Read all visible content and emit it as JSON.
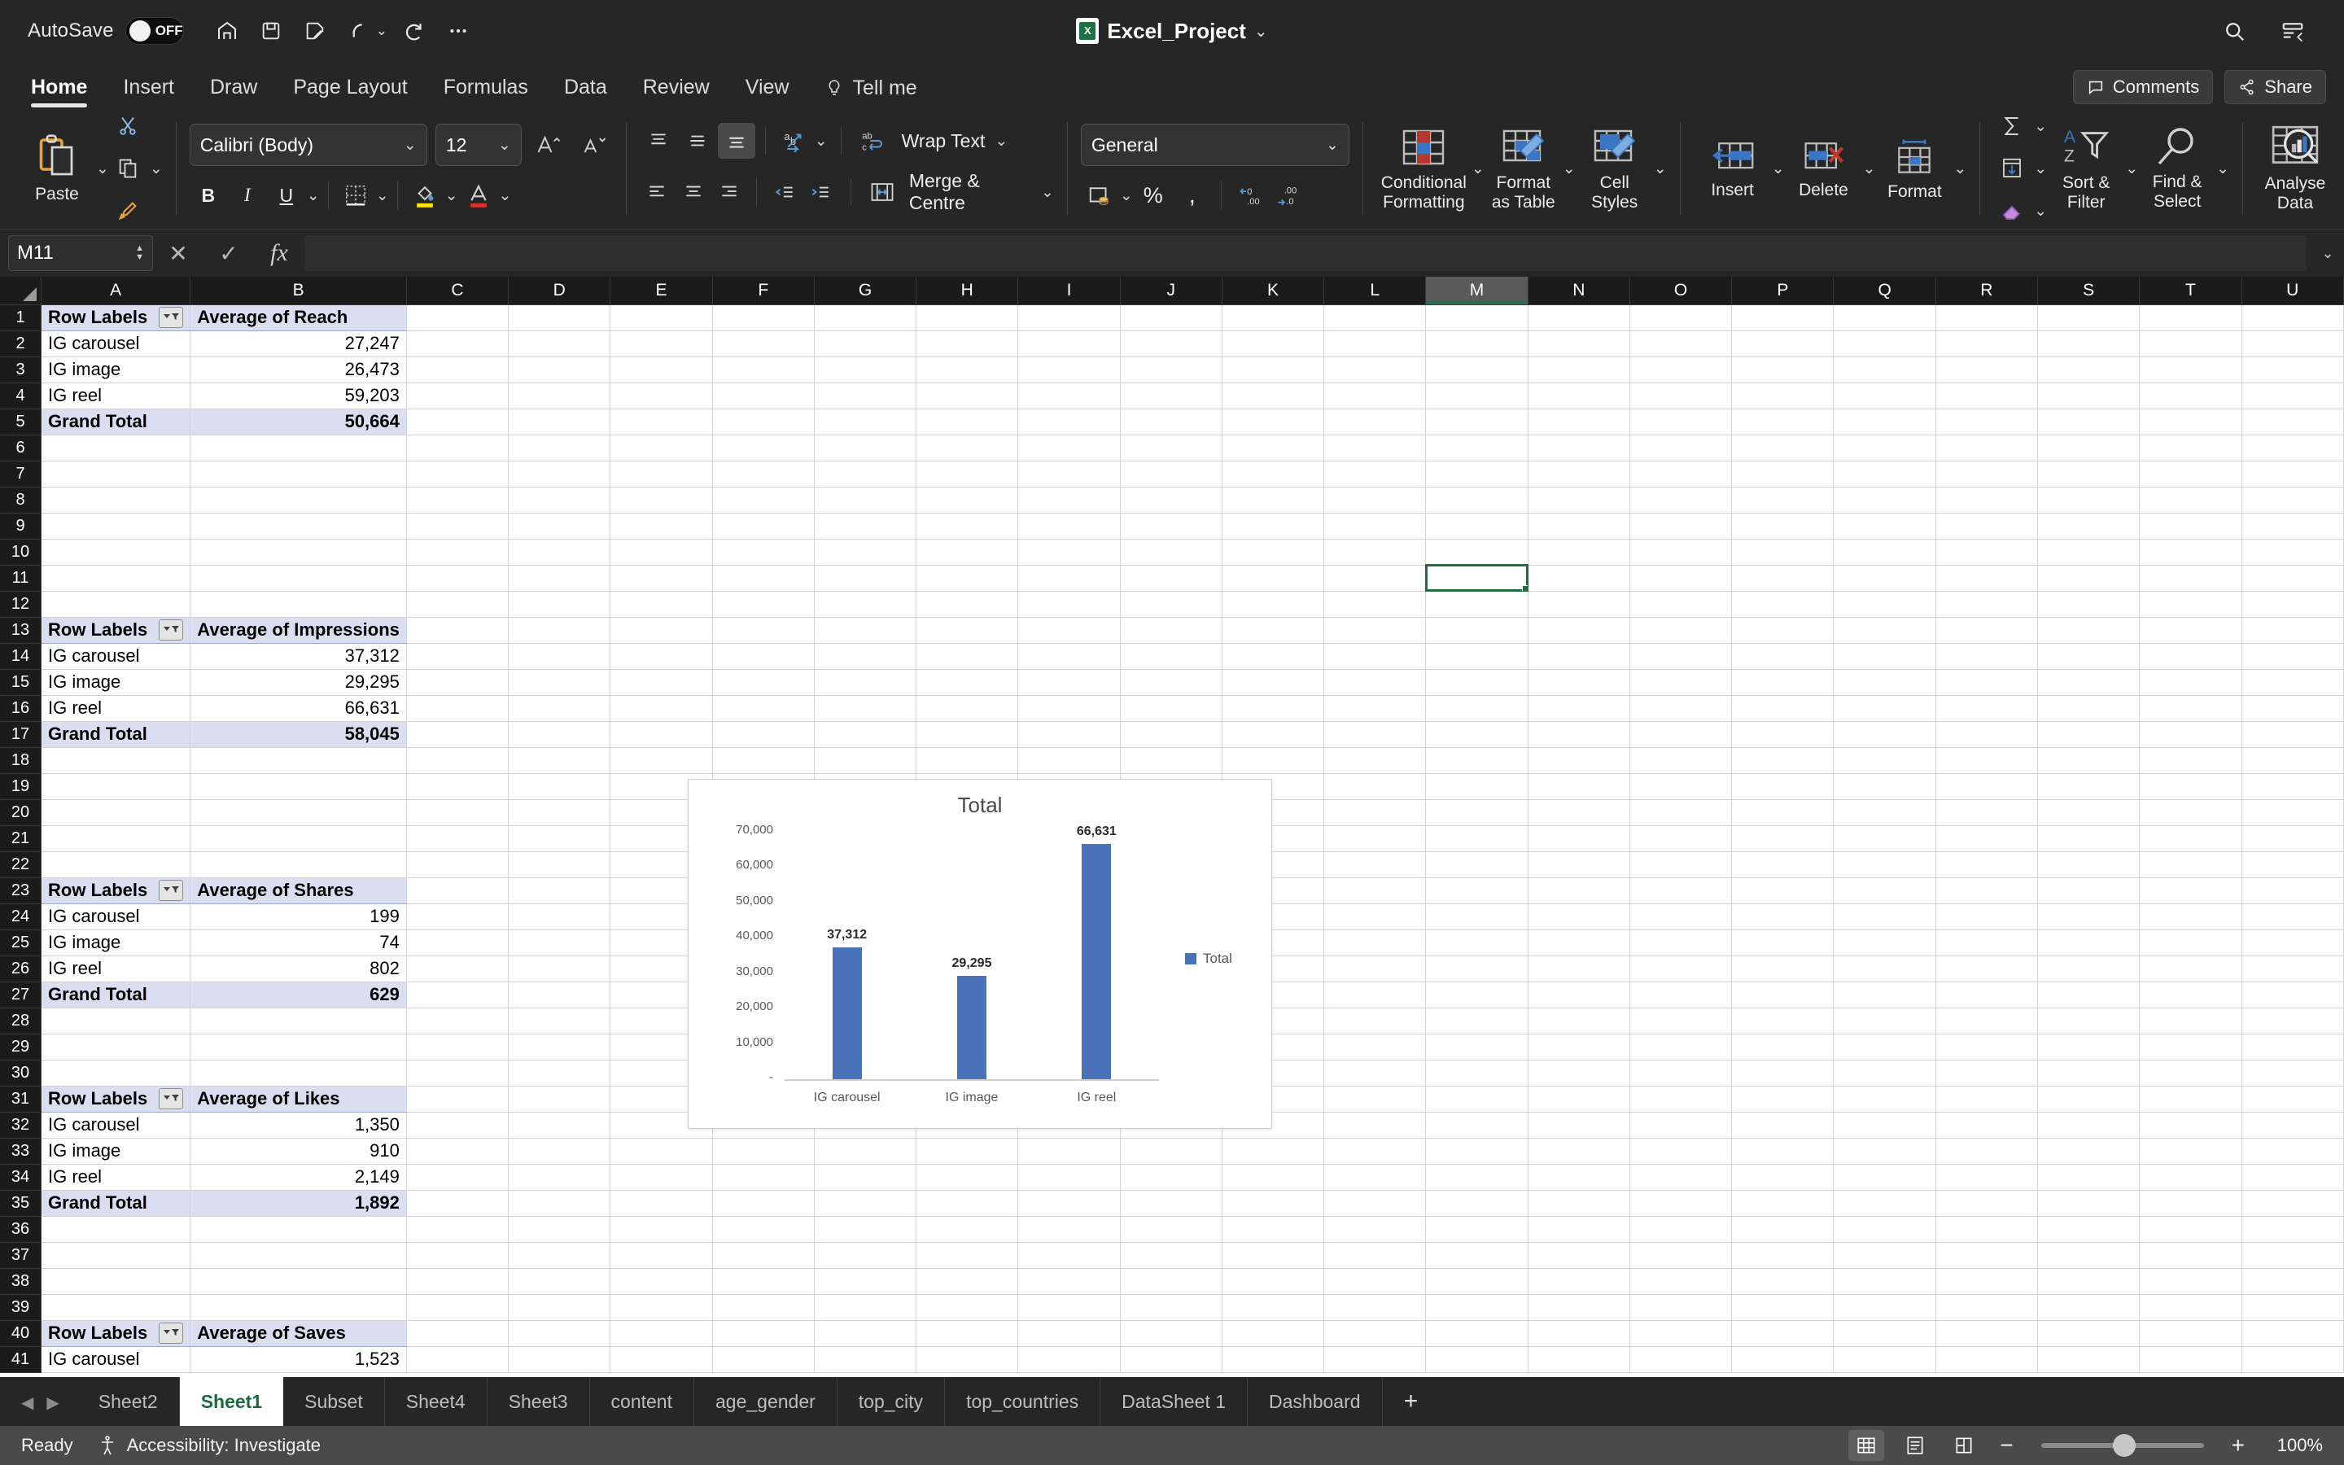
{
  "titlebar": {
    "autosave_label": "AutoSave",
    "autosave_state": "OFF",
    "document_title": "Excel_Project",
    "icons": [
      "home-icon",
      "save-icon",
      "save-as-icon",
      "undo-icon",
      "redo-icon",
      "more-commands-icon",
      "search-icon",
      "ribbon-display-icon"
    ]
  },
  "ribbon_tabs": {
    "items": [
      {
        "label": "Home",
        "active": true
      },
      {
        "label": "Insert",
        "active": false
      },
      {
        "label": "Draw",
        "active": false
      },
      {
        "label": "Page Layout",
        "active": false
      },
      {
        "label": "Formulas",
        "active": false
      },
      {
        "label": "Data",
        "active": false
      },
      {
        "label": "Review",
        "active": false
      },
      {
        "label": "View",
        "active": false
      }
    ],
    "tell_me": "Tell me",
    "comments": "Comments",
    "share": "Share"
  },
  "ribbon": {
    "clipboard": {
      "paste": "Paste",
      "cut": "cut-icon",
      "copy": "copy-icon",
      "format_painter": "format-painter-icon"
    },
    "font": {
      "family": "Calibri (Body)",
      "size": "12",
      "grow": "A^",
      "shrink": "Av",
      "bold": "B",
      "italic": "I",
      "underline": "U",
      "borders": "borders-icon",
      "fill": "fill-color-icon",
      "fontcolor": "font-color-icon"
    },
    "alignment": {
      "wrap_text": "Wrap Text",
      "merge_centre": "Merge & Centre",
      "orientation": "orientation-icon"
    },
    "number": {
      "format": "General",
      "accounting": "accounting-icon",
      "percent": "%",
      "comma": ",",
      "increase_decimal": "increase-decimal-icon",
      "decrease_decimal": "decrease-decimal-icon"
    },
    "styles": {
      "conditional_formatting": "Conditional\nFormatting",
      "conditional_formatting_l1": "Conditional",
      "conditional_formatting_l2": "Formatting",
      "format_as_table_l1": "Format",
      "format_as_table_l2": "as Table",
      "cell_styles_l1": "Cell",
      "cell_styles_l2": "Styles"
    },
    "cells": {
      "insert": "Insert",
      "delete": "Delete",
      "format": "Format"
    },
    "editing": {
      "autosum": "autosum-icon",
      "fill": "fill-down-icon",
      "clear": "clear-icon",
      "sort_filter_l1": "Sort &",
      "sort_filter_l2": "Filter",
      "find_select_l1": "Find &",
      "find_select_l2": "Select"
    },
    "analysis": {
      "analyse_data_l1": "Analyse",
      "analyse_data_l2": "Data"
    }
  },
  "formula_bar": {
    "name_box": "M11",
    "cancel": "cancel-icon",
    "enter": "enter-icon",
    "fx": "fx",
    "value": ""
  },
  "grid": {
    "columns": [
      "A",
      "B",
      "C",
      "D",
      "E",
      "F",
      "G",
      "H",
      "I",
      "J",
      "K",
      "L",
      "M",
      "N",
      "O",
      "P",
      "Q",
      "R",
      "S",
      "T",
      "U"
    ],
    "selected_cell": "M11",
    "selected_column": "M",
    "rows": [
      {
        "n": 1,
        "a": "Row Labels",
        "b": "Average of Reach",
        "kind": "hdr",
        "filter": true
      },
      {
        "n": 2,
        "a": "IG carousel",
        "b": "27,247",
        "kind": "data"
      },
      {
        "n": 3,
        "a": "IG image",
        "b": "26,473",
        "kind": "data"
      },
      {
        "n": 4,
        "a": "IG reel",
        "b": "59,203",
        "kind": "data"
      },
      {
        "n": 5,
        "a": "Grand Total",
        "b": "50,664",
        "kind": "tot"
      },
      {
        "n": 6,
        "a": "",
        "b": "",
        "kind": "empty"
      },
      {
        "n": 7,
        "a": "",
        "b": "",
        "kind": "empty"
      },
      {
        "n": 8,
        "a": "",
        "b": "",
        "kind": "empty"
      },
      {
        "n": 9,
        "a": "",
        "b": "",
        "kind": "empty"
      },
      {
        "n": 10,
        "a": "",
        "b": "",
        "kind": "empty"
      },
      {
        "n": 11,
        "a": "",
        "b": "",
        "kind": "empty"
      },
      {
        "n": 12,
        "a": "",
        "b": "",
        "kind": "empty"
      },
      {
        "n": 13,
        "a": "Row Labels",
        "b": "Average of Impressions",
        "kind": "hdr",
        "filter": true
      },
      {
        "n": 14,
        "a": "IG carousel",
        "b": "37,312",
        "kind": "data"
      },
      {
        "n": 15,
        "a": "IG image",
        "b": "29,295",
        "kind": "data"
      },
      {
        "n": 16,
        "a": "IG reel",
        "b": "66,631",
        "kind": "data"
      },
      {
        "n": 17,
        "a": "Grand Total",
        "b": "58,045",
        "kind": "tot"
      },
      {
        "n": 18,
        "a": "",
        "b": "",
        "kind": "empty"
      },
      {
        "n": 19,
        "a": "",
        "b": "",
        "kind": "empty"
      },
      {
        "n": 20,
        "a": "",
        "b": "",
        "kind": "empty"
      },
      {
        "n": 21,
        "a": "",
        "b": "",
        "kind": "empty"
      },
      {
        "n": 22,
        "a": "",
        "b": "",
        "kind": "empty"
      },
      {
        "n": 23,
        "a": "Row Labels",
        "b": "Average of Shares",
        "kind": "hdr",
        "filter": true
      },
      {
        "n": 24,
        "a": "IG carousel",
        "b": "199",
        "kind": "data"
      },
      {
        "n": 25,
        "a": "IG image",
        "b": "74",
        "kind": "data"
      },
      {
        "n": 26,
        "a": "IG reel",
        "b": "802",
        "kind": "data"
      },
      {
        "n": 27,
        "a": "Grand Total",
        "b": "629",
        "kind": "tot"
      },
      {
        "n": 28,
        "a": "",
        "b": "",
        "kind": "empty"
      },
      {
        "n": 29,
        "a": "",
        "b": "",
        "kind": "empty"
      },
      {
        "n": 30,
        "a": "",
        "b": "",
        "kind": "empty"
      },
      {
        "n": 31,
        "a": "Row Labels",
        "b": "Average of Likes",
        "kind": "hdr",
        "filter": true
      },
      {
        "n": 32,
        "a": "IG carousel",
        "b": "1,350",
        "kind": "data"
      },
      {
        "n": 33,
        "a": "IG image",
        "b": "910",
        "kind": "data"
      },
      {
        "n": 34,
        "a": "IG reel",
        "b": "2,149",
        "kind": "data"
      },
      {
        "n": 35,
        "a": "Grand Total",
        "b": "1,892",
        "kind": "tot"
      },
      {
        "n": 36,
        "a": "",
        "b": "",
        "kind": "empty"
      },
      {
        "n": 37,
        "a": "",
        "b": "",
        "kind": "empty"
      },
      {
        "n": 38,
        "a": "",
        "b": "",
        "kind": "empty"
      },
      {
        "n": 39,
        "a": "",
        "b": "",
        "kind": "empty"
      },
      {
        "n": 40,
        "a": "Row Labels",
        "b": "Average of Saves",
        "kind": "hdr",
        "filter": true
      },
      {
        "n": 41,
        "a": "IG carousel",
        "b": "1,523",
        "kind": "data"
      }
    ]
  },
  "chart_data": {
    "type": "bar",
    "title": "Total",
    "categories": [
      "IG carousel",
      "IG image",
      "IG reel"
    ],
    "values": [
      37312,
      29295,
      66631
    ],
    "data_labels": [
      "37,312",
      "29,295",
      "66,631"
    ],
    "series": [
      {
        "name": "Total",
        "values": [
          37312,
          29295,
          66631
        ],
        "color": "#4a72b8"
      }
    ],
    "legend": [
      "Total"
    ],
    "legend_position": "right",
    "xlabel": "",
    "ylabel": "",
    "ylim": [
      0,
      70000
    ],
    "yticks": [
      0,
      10000,
      20000,
      30000,
      40000,
      50000,
      60000,
      70000
    ],
    "ytick_labels": [
      "-",
      "10,000",
      "20,000",
      "30,000",
      "40,000",
      "50,000",
      "60,000",
      "70,000"
    ],
    "grid": false
  },
  "sheet_tabs": {
    "items": [
      "Sheet2",
      "Sheet1",
      "Subset",
      "Sheet4",
      "Sheet3",
      "content",
      "age_gender",
      "top_city",
      "top_countries",
      "DataSheet 1",
      "Dashboard"
    ],
    "active": "Sheet1",
    "add_label": "+",
    "prev": "prev-sheet-icon",
    "next": "next-sheet-icon"
  },
  "status_bar": {
    "ready": "Ready",
    "accessibility": "Accessibility: Investigate",
    "views": [
      "normal-view-icon",
      "page-layout-view-icon",
      "page-break-view-icon"
    ],
    "active_view": 0,
    "zoom_out": "−",
    "zoom_in": "+",
    "zoom_level": "100%"
  }
}
